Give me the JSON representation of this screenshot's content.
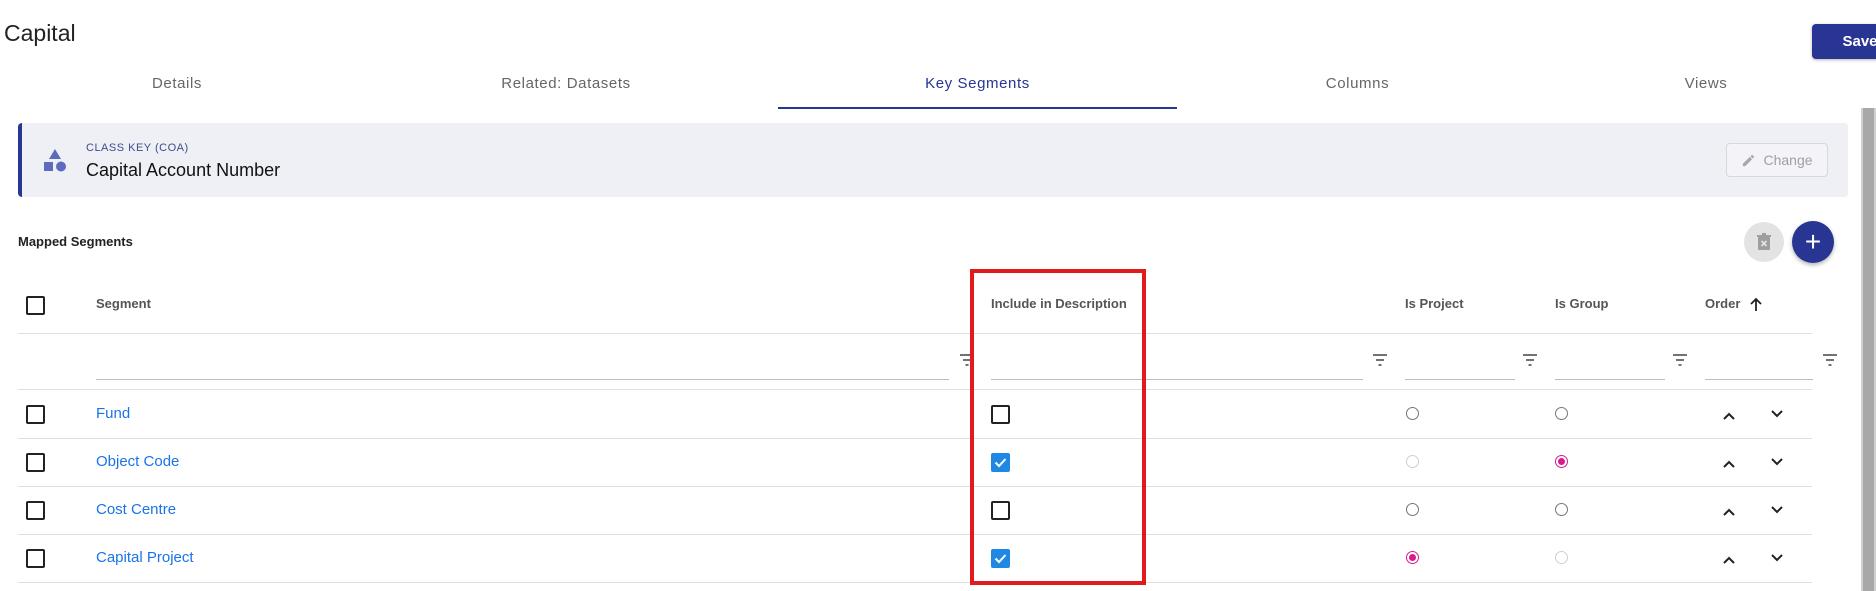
{
  "page": {
    "title": "Capital"
  },
  "toolbar": {
    "save_label": "Save"
  },
  "tabs": [
    {
      "label": "Details"
    },
    {
      "label": "Related: Datasets"
    },
    {
      "label": "Key Segments"
    },
    {
      "label": "Columns"
    },
    {
      "label": "Views"
    }
  ],
  "active_tab": "Key Segments",
  "class_key": {
    "label": "CLASS KEY (COA)",
    "value": "Capital Account Number",
    "change_label": "Change",
    "icon": "shapes-icon"
  },
  "mapped_segments": {
    "title": "Mapped Segments",
    "columns": {
      "segment": "Segment",
      "include": "Include in Description",
      "is_project": "Is Project",
      "is_group": "Is Group",
      "order": "Order"
    },
    "order_sort": "ascending",
    "rows": [
      {
        "segment": "Fund",
        "include": false,
        "is_project": "unselected",
        "is_group": "unselected"
      },
      {
        "segment": "Object Code",
        "include": true,
        "is_project": "disabled",
        "is_group": "selected"
      },
      {
        "segment": "Cost Centre",
        "include": false,
        "is_project": "unselected",
        "is_group": "unselected"
      },
      {
        "segment": "Capital Project",
        "include": true,
        "is_project": "selected",
        "is_group": "disabled"
      }
    ]
  },
  "colors": {
    "accent": "#283593",
    "link": "#1a73e8",
    "checkbox_checked": "#1e88e5",
    "radio_selected": "#d81b8c",
    "highlight": "#e11b1b"
  }
}
